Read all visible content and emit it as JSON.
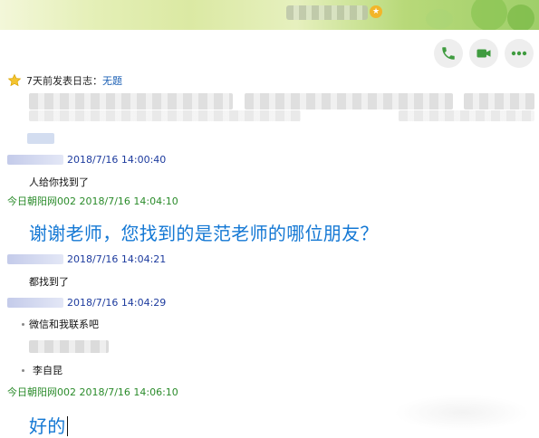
{
  "header": {
    "title_icon": "level-star-icon"
  },
  "toolbar": {
    "call_icon": "phone-icon",
    "video_icon": "video-icon",
    "more_icon": "more-icon"
  },
  "diary": {
    "text": "7天前发表日志：",
    "link": "无题"
  },
  "messages": [
    {
      "time": "2018/7/16 14:00:40",
      "text": "人给你找到了"
    },
    {
      "sender": "今日朝阳网002",
      "time": "2018/7/16 14:04:10",
      "text": "谢谢老师，您找到的是范老师的哪位朋友？"
    },
    {
      "time": "2018/7/16 14:04:21",
      "text": "都找到了"
    },
    {
      "time": "2018/7/16 14:04:29",
      "lines": [
        "微信和我联系吧",
        "李自昆"
      ]
    },
    {
      "sender": "今日朝阳网002",
      "time": "2018/7/16 14:06:10",
      "text": "好的"
    }
  ],
  "colors": {
    "accent_blue": "#1478d4",
    "self_name_green": "#2a8b2a",
    "other_name_blue": "#1d3b9e",
    "icon_green": "#3f9b3f"
  }
}
